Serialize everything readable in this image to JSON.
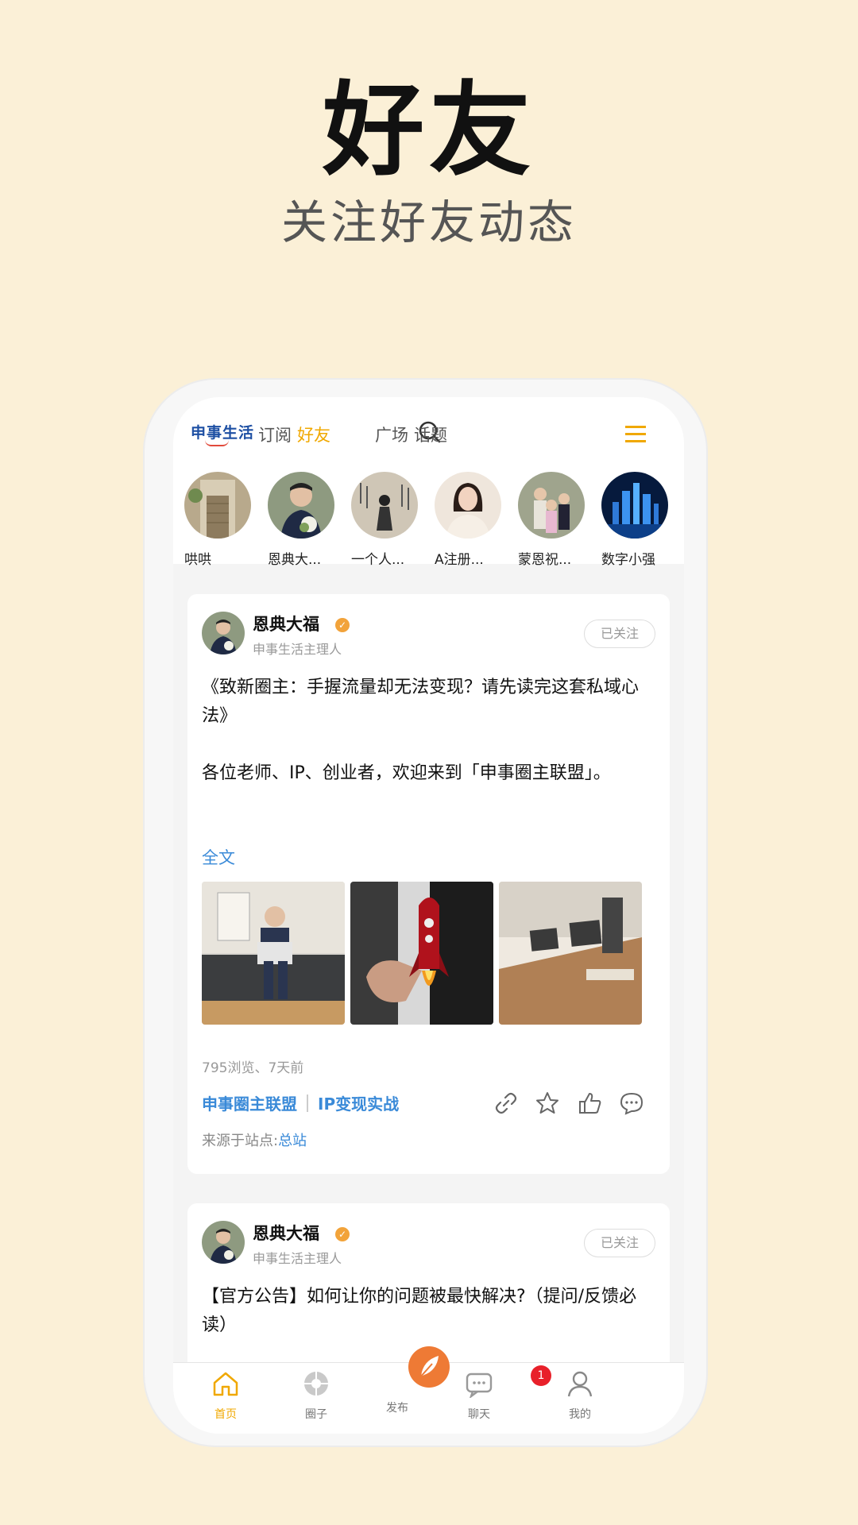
{
  "hero": {
    "title": "好友",
    "subtitle": "关注好友动态"
  },
  "topbar": {
    "logo": "申事生活",
    "nav": [
      {
        "label": "订阅",
        "active": false
      },
      {
        "label": "好友",
        "active": true
      },
      {
        "label": "广场",
        "active": false
      },
      {
        "label": "话题",
        "active": false
      }
    ],
    "search_icon": "search-icon",
    "menu_icon": "hamburger-menu-icon"
  },
  "stories": [
    {
      "name": "哄哄"
    },
    {
      "name": "恩典大..."
    },
    {
      "name": "一个人..."
    },
    {
      "name": "A注册..."
    },
    {
      "name": "蒙恩祝..."
    },
    {
      "name": "数字小强"
    }
  ],
  "posts": [
    {
      "author": "恩典大福",
      "role": "申事生活主理人",
      "follow_label": "已关注",
      "title": "《致新圈主：手握流量却无法变现？请先读完这套私域心法》",
      "paragraph": "各位老师、IP、创业者，欢迎来到「申事圈主联盟」。",
      "more_label": "全文",
      "meta": "795浏览、7天前",
      "tags": [
        "申事圈主联盟",
        "IP变现实战"
      ],
      "source_prefix": "来源于站点:",
      "source_link": "总站",
      "actions": [
        "link-icon",
        "star-icon",
        "thumbs-up-icon",
        "comment-icon"
      ]
    },
    {
      "author": "恩典大福",
      "role": "申事生活主理人",
      "follow_label": "已关注",
      "title": "【官方公告】如何让你的问题被最快解决?（提问/反馈必读）"
    }
  ],
  "tabbar": [
    {
      "label": "首页",
      "icon": "home-icon",
      "active": true
    },
    {
      "label": "圈子",
      "icon": "circle-icon",
      "active": false
    },
    {
      "label": "发布",
      "icon": "feather-icon",
      "active": false
    },
    {
      "label": "聊天",
      "icon": "chat-icon",
      "active": false,
      "badge": "1"
    },
    {
      "label": "我的",
      "icon": "profile-icon",
      "active": false
    }
  ],
  "colors": {
    "background": "#fbf0d7",
    "accent": "#f0a800",
    "link": "#3a8ad8",
    "publish": "#ee7a35",
    "badge": "#e8202a"
  }
}
